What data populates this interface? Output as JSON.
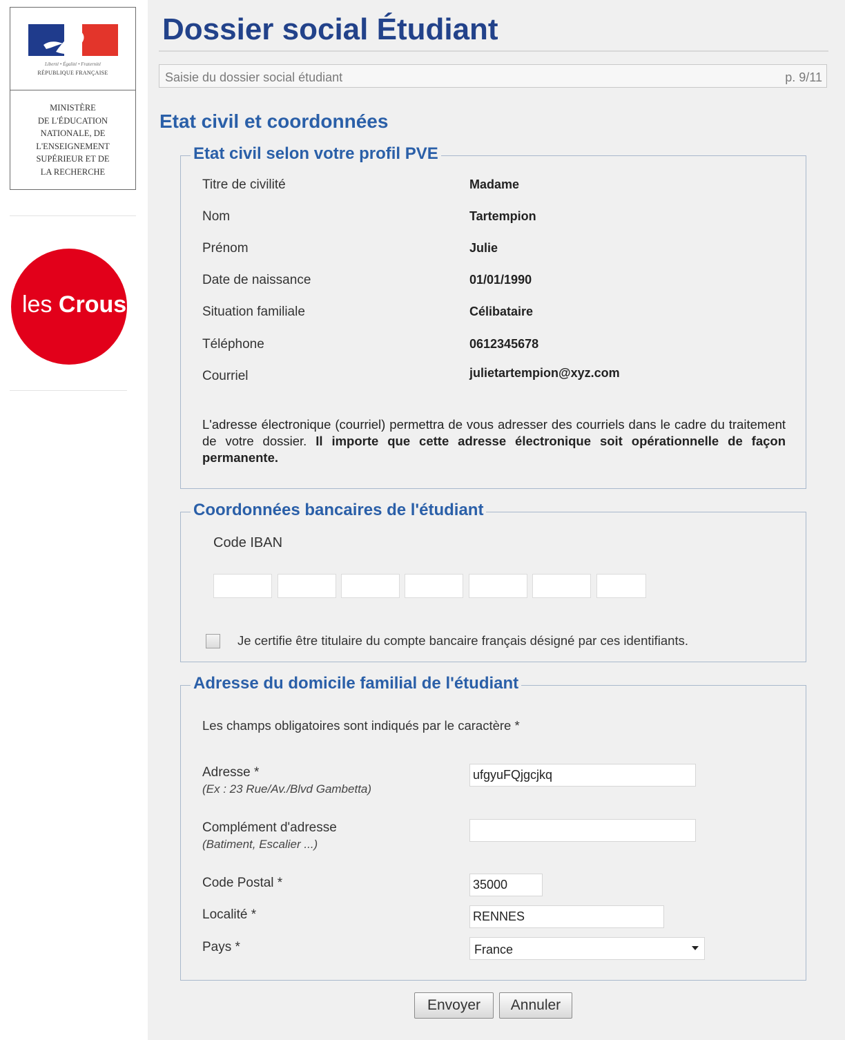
{
  "sidebar": {
    "republique_devise": "Liberté • Égalité • Fraternité",
    "republique_label": "RÉPUBLIQUE FRANÇAISE",
    "ministere_lines": [
      "MINISTÈRE",
      "DE L'ÉDUCATION",
      "NATIONALE, DE",
      "L'ENSEIGNEMENT",
      "SUPÉRIEUR ET DE",
      "LA RECHERCHE"
    ],
    "crous_prefix": "les",
    "crous_name": "Crous",
    "colors": {
      "flag_blue": "#1f3b8c",
      "flag_red": "#e3352b",
      "crous_red": "#e2001a"
    }
  },
  "header": {
    "title": "Dossier social Étudiant",
    "subtitle": "Saisie du dossier social étudiant",
    "page_indicator": "p. 9/11"
  },
  "section_title": "Etat civil et coordonnées",
  "etat_civil": {
    "legend": "Etat civil selon votre profil PVE",
    "rows": [
      {
        "label": "Titre de civilité",
        "value": "Madame"
      },
      {
        "label": "Nom",
        "value": "Tartempion"
      },
      {
        "label": "Prénom",
        "value": "Julie"
      },
      {
        "label": "Date de naissance",
        "value": "01/01/1990"
      },
      {
        "label": "Situation familiale",
        "value": "Célibataire"
      },
      {
        "label": "Téléphone",
        "value": "0612345678"
      },
      {
        "label": "Courriel",
        "value": "julietartempion@xyz.com"
      }
    ],
    "note_normal": "L'adresse électronique (courriel) permettra de vous adresser des courriels dans le cadre du traitement de votre dossier. ",
    "note_bold": "Il importe que cette adresse électronique soit opérationnelle de façon permanente."
  },
  "banque": {
    "legend": "Coordonnées bancaires de l'étudiant",
    "iban_label": "Code IBAN",
    "iban_values": [
      "",
      "",
      "",
      "",
      "",
      "",
      ""
    ],
    "certify_label": "Je certifie être titulaire du compte bancaire français désigné par ces identifiants."
  },
  "adresse": {
    "legend": "Adresse du domicile familial de l'étudiant",
    "mandatory_note": "Les champs obligatoires sont indiqués par le caractère *",
    "adresse_label": "Adresse *",
    "adresse_hint": "(Ex : 23 Rue/Av./Blvd Gambetta)",
    "adresse_value": "ufgyuFQjgcjkq",
    "complement_label": "Complément d'adresse",
    "complement_hint": "(Batiment, Escalier ...)",
    "complement_value": "",
    "code_postal_label": "Code Postal *",
    "code_postal_value": "35000",
    "localite_label": "Localité *",
    "localite_value": "RENNES",
    "pays_label": "Pays *",
    "pays_value": "France"
  },
  "actions": {
    "submit_label": "Envoyer",
    "cancel_label": "Annuler"
  }
}
